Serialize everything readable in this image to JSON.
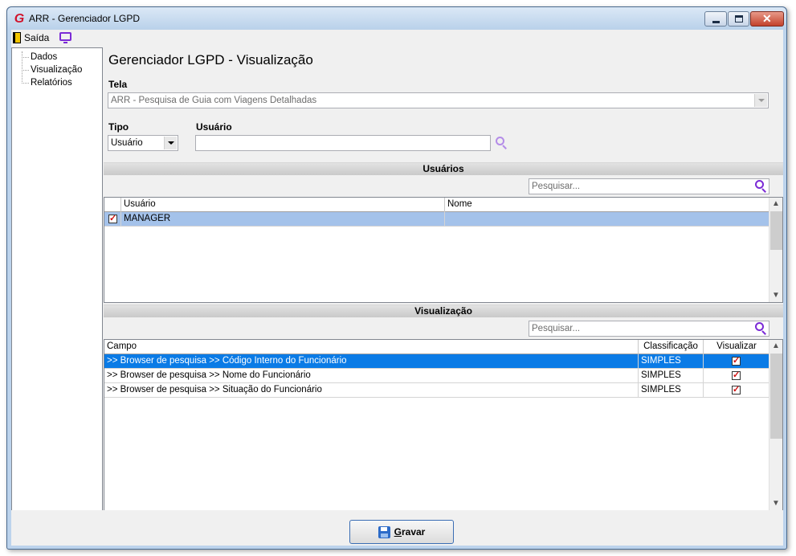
{
  "window": {
    "title": "ARR - Gerenciador LGPD",
    "logo_letter": "G"
  },
  "menu": {
    "exit_label": "Saída"
  },
  "tree": {
    "items": [
      {
        "label": "Dados"
      },
      {
        "label": "Visualização"
      },
      {
        "label": "Relatórios"
      }
    ]
  },
  "page": {
    "title": "Gerenciador LGPD - Visualização"
  },
  "form": {
    "tela_label": "Tela",
    "tela_value": "ARR - Pesquisa de Guia com Viagens Detalhadas",
    "tipo_label": "Tipo",
    "tipo_value": "Usuário",
    "usuario_label": "Usuário",
    "usuario_value": ""
  },
  "usuarios": {
    "section_title": "Usuários",
    "search_placeholder": "Pesquisar...",
    "columns": [
      "Usuário",
      "Nome"
    ],
    "rows": [
      {
        "checked": true,
        "usuario": "MANAGER",
        "nome": ""
      }
    ]
  },
  "visualizacao": {
    "section_title": "Visualização",
    "search_placeholder": "Pesquisar...",
    "columns": [
      "Campo",
      "Classificação",
      "Visualizar"
    ],
    "rows": [
      {
        "campo": ">> Browser de pesquisa >> Código Interno do Funcionário",
        "classificacao": "SIMPLES",
        "visualizar": true
      },
      {
        "campo": ">> Browser de pesquisa >> Nome do Funcionário",
        "classificacao": "SIMPLES",
        "visualizar": true
      },
      {
        "campo": ">> Browser de pesquisa >> Situação do Funcionário",
        "classificacao": "SIMPLES",
        "visualizar": true
      }
    ]
  },
  "actions": {
    "gravar_first": "G",
    "gravar_rest": "ravar"
  },
  "colors": {
    "selection_dark": "#0a7be6",
    "selection_light": "#a4c2ea",
    "accent_icon": "#7b2bd6",
    "check_mark": "#d01010"
  },
  "icons": {
    "exit": "door-icon",
    "display": "monitor-icon",
    "search": "magnifier-icon",
    "save": "floppy-icon"
  }
}
